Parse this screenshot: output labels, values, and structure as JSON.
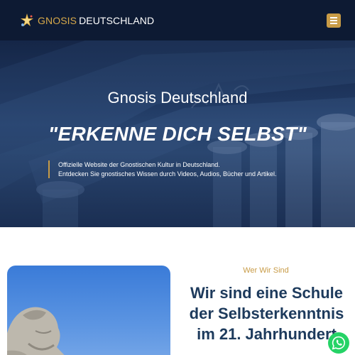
{
  "header": {
    "logo_part1": "GNOSIS",
    "logo_part2": "DEUTSCHLAND",
    "menu_icon": "hamburger-menu-icon"
  },
  "hero": {
    "title": "Gnosis Deutschland",
    "quote": "\"ERKENNE DICH SELBST\"",
    "desc_line1": "Offizielle Website der Gnostischen Kultur in Deutschland.",
    "desc_line2": "Entdecken Sie gnostisches Wissen durch Videos, Audios, Bücher und Artikel."
  },
  "about": {
    "eyebrow": "Wer Wir Sind",
    "heading_line1": "Wir sind eine Schule",
    "heading_line2": "der Selbsterkenntnis",
    "heading_line3": "im 21. Jahrhundert"
  },
  "colors": {
    "header_bg": "#0d1a33",
    "accent_gold": "#c89b46",
    "heading_navy": "#1d3a5c",
    "whatsapp_green": "#25d366"
  },
  "floating": {
    "whatsapp_icon": "whatsapp-icon"
  }
}
